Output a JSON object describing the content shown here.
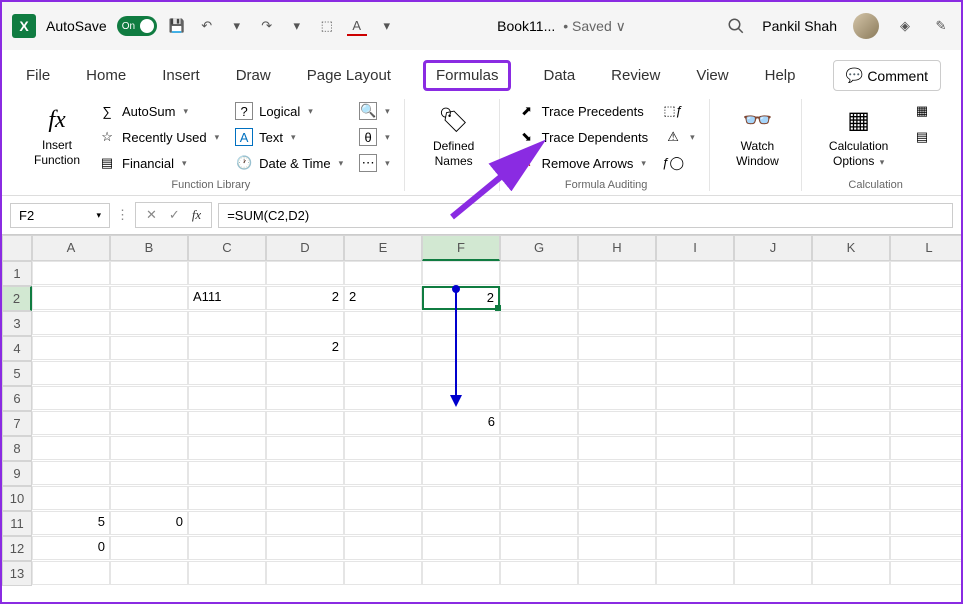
{
  "titlebar": {
    "autosave_label": "AutoSave",
    "autosave_state": "On",
    "book_name": "Book11...",
    "saved_label": "• Saved ∨",
    "user_name": "Pankil Shah"
  },
  "tabs": {
    "file": "File",
    "home": "Home",
    "insert": "Insert",
    "draw": "Draw",
    "page_layout": "Page Layout",
    "formulas": "Formulas",
    "data": "Data",
    "review": "Review",
    "view": "View",
    "help": "Help",
    "comment": "Comment"
  },
  "ribbon": {
    "insert_function": "Insert\nFunction",
    "autosum": "AutoSum",
    "recently_used": "Recently Used",
    "financial": "Financial",
    "logical": "Logical",
    "text": "Text",
    "date_time": "Date & Time",
    "defined_names": "Defined\nNames",
    "trace_precedents": "Trace Precedents",
    "trace_dependents": "Trace Dependents",
    "remove_arrows": "Remove Arrows",
    "watch_window": "Watch\nWindow",
    "calc_options": "Calculation\nOptions",
    "group_function_library": "Function Library",
    "group_formula_auditing": "Formula Auditing",
    "group_calculation": "Calculation"
  },
  "formula_bar": {
    "name_box": "F2",
    "formula": "=SUM(C2,D2)"
  },
  "columns": [
    "A",
    "B",
    "C",
    "D",
    "E",
    "F",
    "G",
    "H",
    "I",
    "J",
    "K",
    "L"
  ],
  "rows": [
    "1",
    "2",
    "3",
    "4",
    "5",
    "6",
    "7",
    "8",
    "9",
    "10",
    "11",
    "12",
    "13"
  ],
  "cells": {
    "C2": "A111",
    "D2": "2",
    "E2": "2",
    "F2": "2",
    "D4": "2",
    "F7": "6",
    "A11": "5",
    "B11": "0",
    "A12": "0"
  },
  "selected_cell": "F2"
}
